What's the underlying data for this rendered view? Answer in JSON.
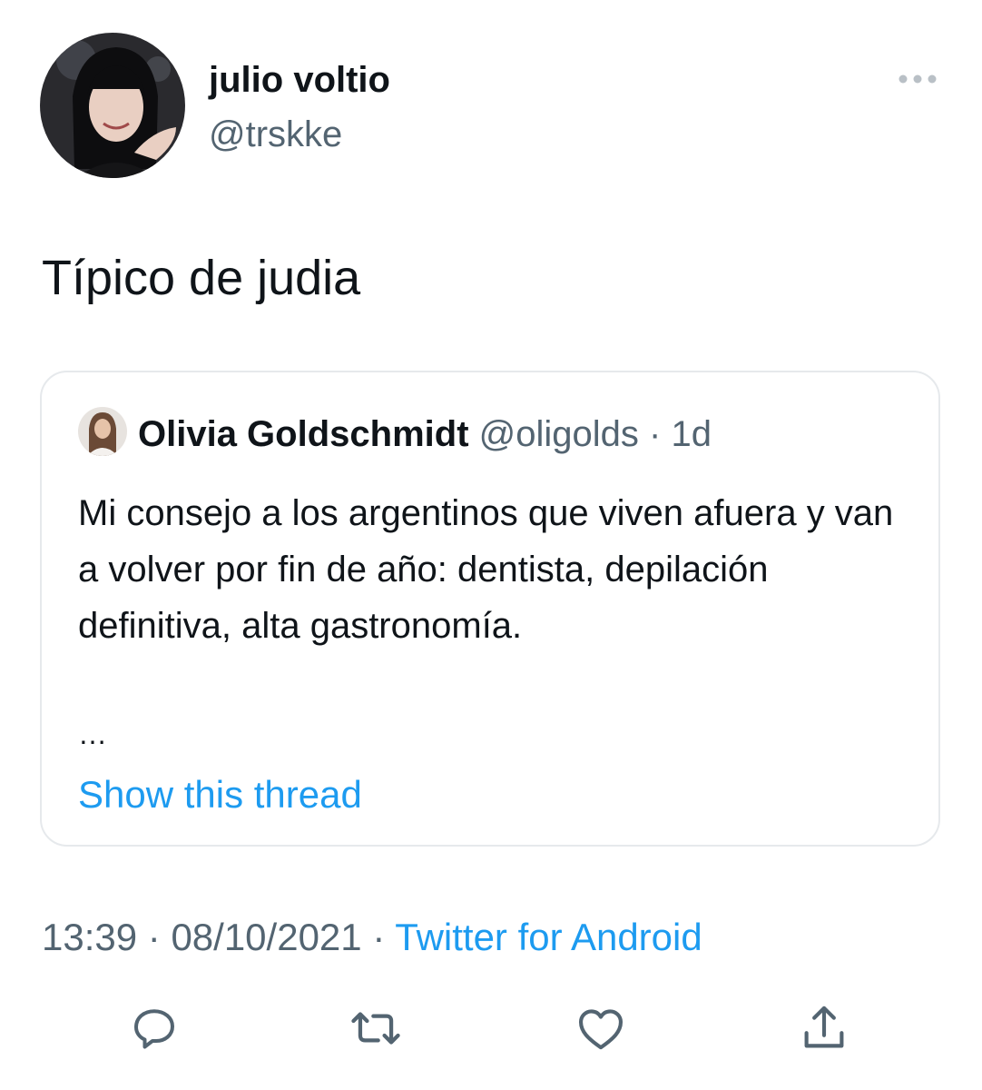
{
  "author": {
    "name": "julio voltio",
    "handle": "@trskke",
    "avatar_icon": "profile-photo"
  },
  "menu": {
    "more_icon": "more-horizontal-icon"
  },
  "tweet": {
    "text": "Típico de judia"
  },
  "quoted_tweet": {
    "author_name": "Olivia Goldschmidt",
    "handle": "@oligolds",
    "separator": "·",
    "age": "1d",
    "text": "Mi consejo a los argentinos que viven afuera y van a volver por fin de año: dentista, depilación definitiva, alta gastronomía.",
    "ellipsis": "…",
    "show_thread_label": "Show this thread"
  },
  "meta": {
    "time": "13:39",
    "separator1": " · ",
    "date": "08/10/2021",
    "separator2": " · ",
    "source": "Twitter for Android"
  },
  "actions": [
    {
      "name": "reply",
      "icon": "reply-icon"
    },
    {
      "name": "retweet",
      "icon": "retweet-icon"
    },
    {
      "name": "like",
      "icon": "heart-icon"
    },
    {
      "name": "share",
      "icon": "share-icon"
    }
  ],
  "colors": {
    "text_primary": "#0f1419",
    "text_secondary": "#536471",
    "link": "#1d9bf0",
    "border": "#e6e9ec"
  }
}
